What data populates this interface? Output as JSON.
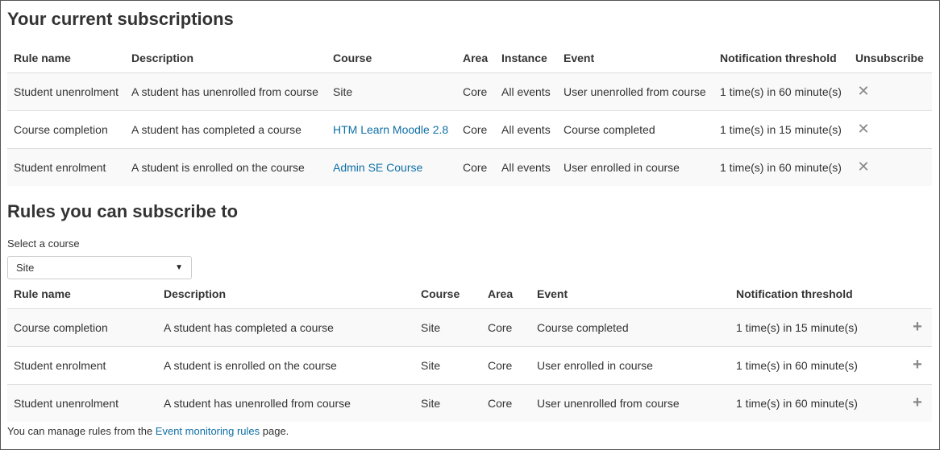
{
  "current": {
    "heading": "Your current subscriptions",
    "columns": [
      "Rule name",
      "Description",
      "Course",
      "Area",
      "Instance",
      "Event",
      "Notification threshold",
      "Unsubscribe"
    ],
    "rows": [
      {
        "rule": "Student unenrolment",
        "description": "A student has unenrolled from course",
        "course": "Site",
        "course_link": false,
        "area": "Core",
        "instance": "All events",
        "event": "User unenrolled from course",
        "threshold": "1 time(s) in 60 minute(s)"
      },
      {
        "rule": "Course completion",
        "description": "A student has completed a course",
        "course": "HTM Learn Moodle 2.8",
        "course_link": true,
        "area": "Core",
        "instance": "All events",
        "event": "Course completed",
        "threshold": "1 time(s) in 15 minute(s)"
      },
      {
        "rule": "Student enrolment",
        "description": "A student is enrolled on the course",
        "course": "Admin SE Course",
        "course_link": true,
        "area": "Core",
        "instance": "All events",
        "event": "User enrolled in course",
        "threshold": "1 time(s) in 60 minute(s)"
      }
    ],
    "unsubscribe_icon": "close-icon"
  },
  "rules": {
    "heading": "Rules you can subscribe to",
    "select_label": "Select a course",
    "select_value": "Site",
    "columns": [
      "Rule name",
      "Description",
      "Course",
      "Area",
      "Event",
      "Notification threshold"
    ],
    "rows": [
      {
        "rule": "Course completion",
        "description": "A student has completed a course",
        "course": "Site",
        "area": "Core",
        "event": "Course completed",
        "threshold": "1 time(s) in 15 minute(s)"
      },
      {
        "rule": "Student enrolment",
        "description": "A student is enrolled on the course",
        "course": "Site",
        "area": "Core",
        "event": "User enrolled in course",
        "threshold": "1 time(s) in 60 minute(s)"
      },
      {
        "rule": "Student unenrolment",
        "description": "A student has unenrolled from course",
        "course": "Site",
        "area": "Core",
        "event": "User unenrolled from course",
        "threshold": "1 time(s) in 60 minute(s)"
      }
    ],
    "subscribe_icon": "plus-icon"
  },
  "footer": {
    "prefix": "You can manage rules from the ",
    "link": "Event monitoring rules",
    "suffix": " page."
  },
  "colors": {
    "link": "#0f6fa5",
    "stripe": "#f9f9f9",
    "border": "#dddddd"
  }
}
